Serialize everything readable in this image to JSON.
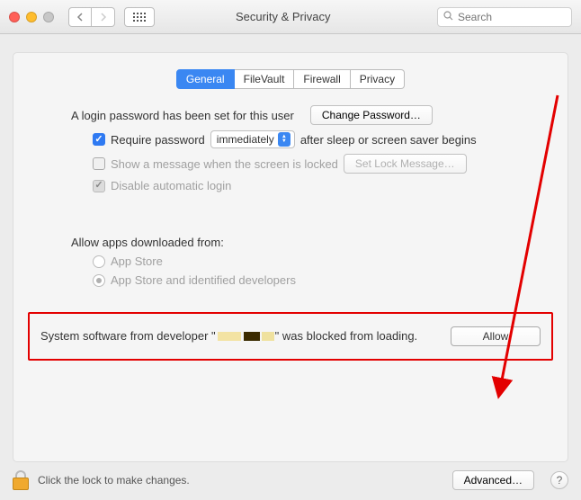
{
  "window": {
    "title": "Security & Privacy"
  },
  "search": {
    "placeholder": "Search"
  },
  "tabs": {
    "general": "General",
    "filevault": "FileVault",
    "firewall": "Firewall",
    "privacy": "Privacy"
  },
  "login": {
    "text": "A login password has been set for this user",
    "change_btn": "Change Password…",
    "require_pw": "Require password",
    "dropdown_value": "immediately",
    "after_text": "after sleep or screen saver begins",
    "show_msg": "Show a message when the screen is locked",
    "set_lock_btn": "Set Lock Message…",
    "disable_auto": "Disable automatic login"
  },
  "download": {
    "label": "Allow apps downloaded from:",
    "appstore": "App Store",
    "appstore_dev": "App Store and identified developers"
  },
  "blocked": {
    "prefix": "System software from developer \"",
    "suffix": "\" was blocked from loading.",
    "allow": "Allow"
  },
  "footer": {
    "lock_text": "Click the lock to make changes.",
    "advanced": "Advanced…"
  }
}
